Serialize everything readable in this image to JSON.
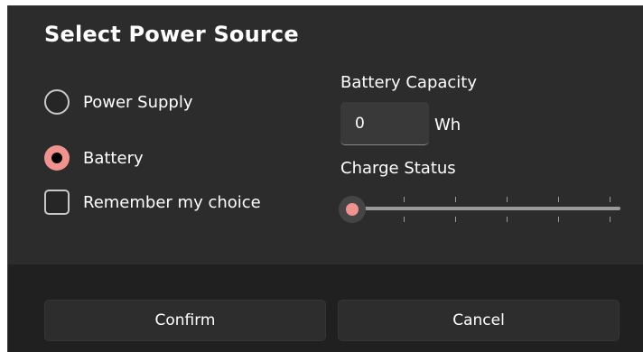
{
  "dialog": {
    "title": "Select Power Source"
  },
  "power_source": {
    "options": [
      {
        "label": "Power Supply",
        "checked": false
      },
      {
        "label": "Battery",
        "checked": true
      }
    ],
    "remember_label": "Remember my choice",
    "remember_checked": false
  },
  "battery_capacity": {
    "label": "Battery Capacity",
    "value": "0",
    "unit": "Wh"
  },
  "charge_status": {
    "label": "Charge Status",
    "value_fraction": 0,
    "tick_count": 5
  },
  "footer": {
    "confirm_label": "Confirm",
    "cancel_label": "Cancel"
  },
  "colors": {
    "accent": "#f0938f",
    "dialog_bg": "#2c2c2c",
    "footer_bg": "#202020",
    "button_bg": "#2d2d2d"
  }
}
